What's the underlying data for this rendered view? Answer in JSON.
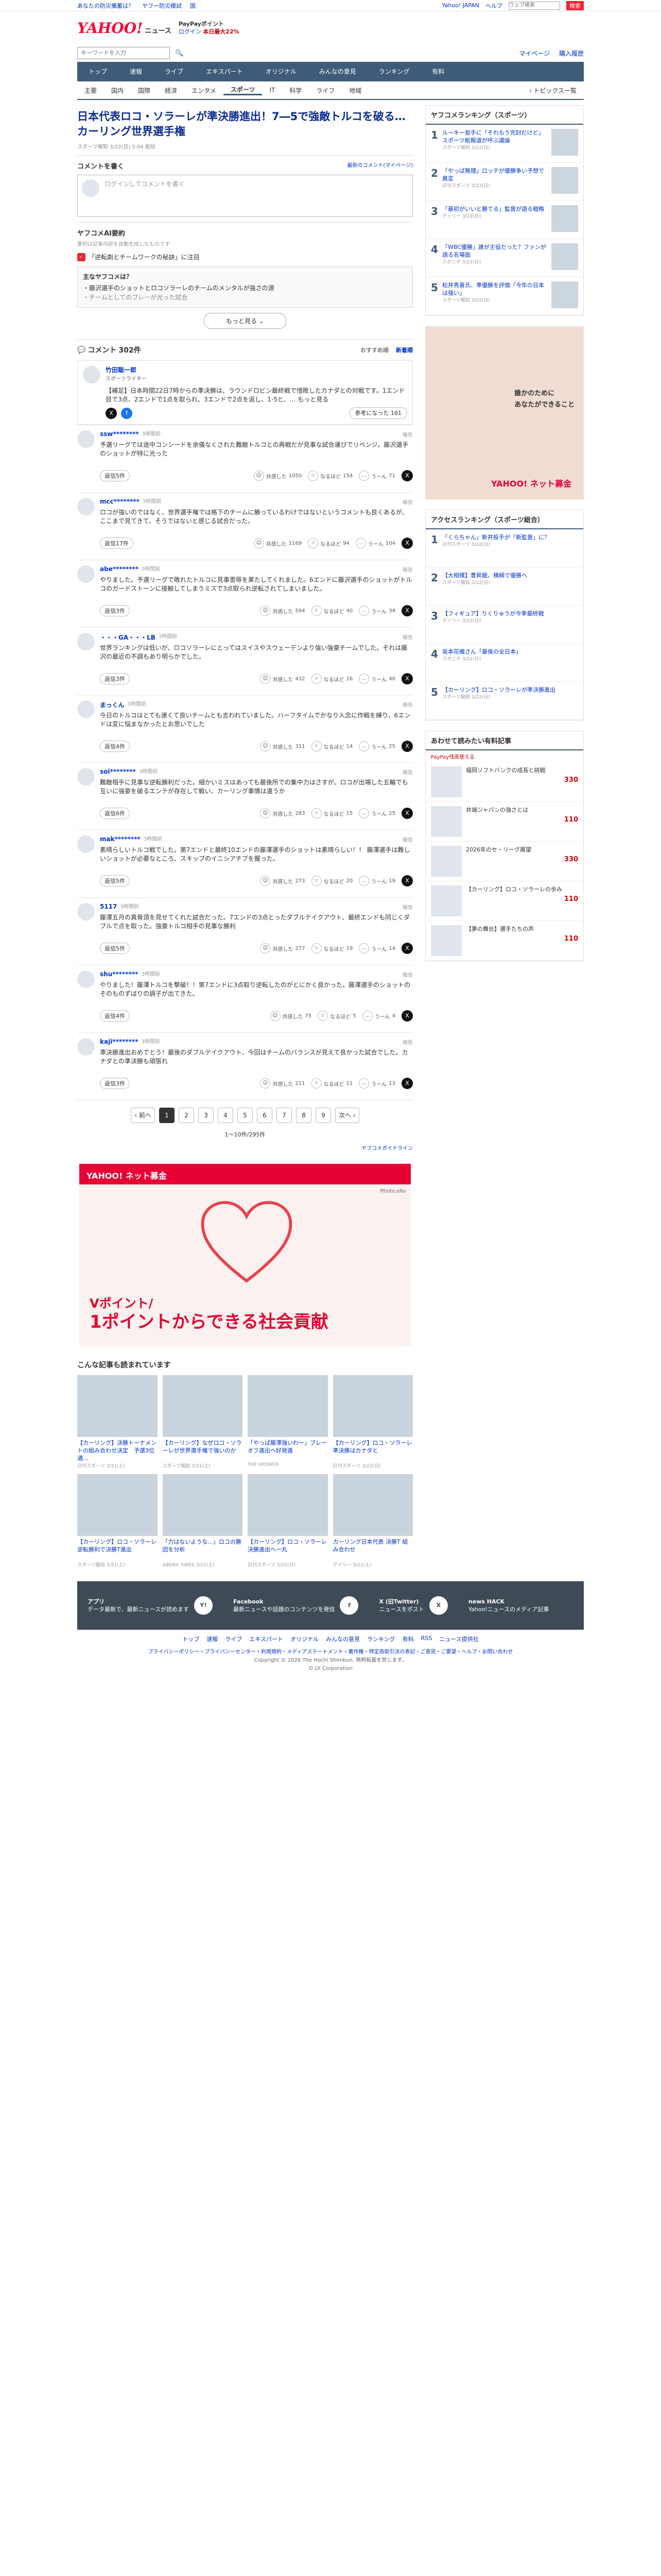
{
  "topline": {
    "links": [
      "あなたの防災備蓄は？",
      "ヤフー防災模試",
      "国"
    ],
    "right": [
      "Yahoo! JAPAN",
      "ヘルプ"
    ],
    "search_placeholder": "ウェブ検索",
    "search_btn": "検索"
  },
  "header": {
    "logo": "YAHOO!",
    "sub": "ニュース",
    "promo1": "PayPayポイント",
    "promo2": "ログイン",
    "promo3": "本日最大22%"
  },
  "search": {
    "placeholder": "キーワードを入力",
    "right": [
      "マイページ",
      "購入履歴"
    ]
  },
  "gnav": [
    "トップ",
    "速報",
    "ライブ",
    "エキスパート",
    "オリジナル",
    "みんなの意見",
    "ランキング",
    "有料"
  ],
  "snav": [
    "主要",
    "国内",
    "国際",
    "経済",
    "エンタメ",
    "スポーツ",
    "IT",
    "科学",
    "ライフ",
    "地域"
  ],
  "snav_right": "トピックス一覧",
  "article": {
    "title": "日本代表ロコ・ソラーレが準決勝進出！7―5で強敵トルコを破る…カーリング世界選手権",
    "meta": "スポーツ報知 3/22(日) 5:04 配信"
  },
  "comment_box": {
    "title": "コメントを書く",
    "right": "最新のコメント(マイページ)",
    "placeholder": "ログインしてコメントを書く"
  },
  "ai": {
    "title": "ヤフコメAI要約",
    "note": "要約は記事内容を自動生成したものです",
    "tag": "「逆転劇とチームワークの秘訣」に注目",
    "box_title": "主なヤフコメは？",
    "b1": "・藤沢選手のショットとロコソラーレのチームのメンタルが強さの源",
    "b2": "・チームとしてのプレーが光った試合",
    "more": "もっと見る"
  },
  "comments_header": {
    "title": "コメント",
    "count": "302件",
    "sort1": "おすすめ順",
    "sort2": "新着順"
  },
  "expert": {
    "name": "竹田聡一郎",
    "role": "スポーツライター",
    "text": "【補足】日本時間22日7時からの準決勝は、ラウンドロビン最終戦で惜敗したカナダとの対戦です。1エンド目で3点、2エンドで1点を取られ、3エンドで2点を返し、1-5と、… もっと見る",
    "btn": "参考になった",
    "count": "161"
  },
  "comments": [
    {
      "name": "ssw********",
      "time": "3時間前",
      "text": "予選リーグでは途中コンシードを余儀なくされた難敵トルコとの再戦だが見事な試合運びでリベンジ。藤沢選手のショットが特に光った",
      "reply": "返信5件",
      "r1": "1050",
      "r2": "154",
      "r3": "71"
    },
    {
      "name": "mcc********",
      "time": "3時間前",
      "text": "ロコが強いのではなく、世界選手権では格下のチームに勝っているわけではないというコメントも良くあるが、ここまで見てきて、そうではないと感じる試合だった。",
      "reply": "返信17件",
      "r1": "1169",
      "r2": "94",
      "r3": "104"
    },
    {
      "name": "abe********",
      "time": "3時間前",
      "text": "やりました。予選リーグで敗れたトルコに見事雪辱を果たしてくれました。6エンドに藤沢選手のショットがトルコのガードストーンに接触してしまうミスで3点取られ逆転されてしまいました。",
      "reply": "返信3件",
      "r1": "594",
      "r2": "40",
      "r3": "34"
    },
    {
      "name": "・・・GA・・・LB",
      "time": "3時間前",
      "text": "世界ランキングは低いが、ロコソラーレにとってはスイスやスウェーデンより強い強豪チームでした。それは藤沢の最近の不調もあり明らかでした。",
      "reply": "返信3件",
      "r1": "432",
      "r2": "26",
      "r3": "40"
    },
    {
      "name": "まっくん",
      "time": "3時間前",
      "text": "今日のトルコはとても速くて良いチームとも言われていました。ハーフタイムでかなり入念に作戦を練り、6エンドは変に悩まなかったとお思いでした",
      "reply": "返信4件",
      "r1": "311",
      "r2": "14",
      "r3": "25"
    },
    {
      "name": "soi********",
      "time": "3時間前",
      "text": "難敵相手に見事な逆転勝利だった。細かいミスはあっても最後所での集中力はさすが。ロコが出場した五輪でも互いに強豪を破るエンテが存在して戦い、カーリング事情は違うか",
      "reply": "返信6件",
      "r1": "283",
      "r2": "15",
      "r3": "25"
    },
    {
      "name": "mak********",
      "time": "3時間前",
      "text": "素晴らしいトルコ戦でした。第7エンドと最終10エンドの藤澤選手のショットは素晴らしい！！ 藤澤選手は難しいショットが必要なところ、スキップのイニシアチブを握った。",
      "reply": "返信5件",
      "r1": "273",
      "r2": "20",
      "r3": "19"
    },
    {
      "name": "5117",
      "time": "3時間前",
      "text": "藤澤五月の真骨頂を見せてくれた試合だった。7エンドの3点とったダブルテイクアウト、最終エンドも同じくダブルで点を取った。強豪トルコ相手の見事な勝利",
      "reply": "返信5件",
      "r1": "277",
      "r2": "19",
      "r3": "14"
    },
    {
      "name": "shu********",
      "time": "3時間前",
      "text": "やりました！藤澤トルコを撃破！！第7エンドに3点取り逆転したのがとにかく良かった。藤澤選手のショットのそのものずばりの調子が出てきた。",
      "reply": "返信4件",
      "r1": "75",
      "r2": "5",
      "r3": "4"
    },
    {
      "name": "kaji********",
      "time": "3時間前",
      "text": "準決勝進出おめでとう！最後のダブルテイクアウト、今回はチームのバランスが見えて良かった試合でした。カナダとの準決勝も頑張れ",
      "reply": "返信3件",
      "r1": "211",
      "r2": "11",
      "r3": "13"
    }
  ],
  "pager": {
    "prev": "前へ",
    "pages": [
      "1",
      "2",
      "3",
      "4",
      "5",
      "6",
      "7",
      "8",
      "9"
    ],
    "next": "次へ",
    "count": "1〜10件/295件"
  },
  "yahoo_guideline": "ヤフコメガイドライン",
  "bigad": {
    "brand": "YAHOO! ネット募金",
    "credit": "Photo.ello",
    "line1": "Vポイント/",
    "line2": "1ポイントからできる社会貢献"
  },
  "related": {
    "title": "こんな記事も読まれています",
    "items": [
      {
        "t": "【カーリング】決勝トーナメントの組み合わせ決定　予選3位通…",
        "m": "日刊スポーツ 3/21(土)"
      },
      {
        "t": "【カーリング】なぜロコ・ソラーレが世界選手権で強いのか",
        "m": "スポーツ報知 3/21(土)"
      },
      {
        "t": "「やっぱ藤澤強いわー」プレーオフ進出へ好発進",
        "m": "THE ANSWER"
      },
      {
        "t": "【カーリング】ロコ・ソラーレ 準決勝はカナダと",
        "m": "日刊スポーツ 3/22(日)"
      },
      {
        "t": "【カーリング】ロコ・ソラーレ逆転勝利で決勝T進出",
        "m": "スポーツ報知 3/21(土)"
      },
      {
        "t": "「力はないような...」ロコの勝因を分析",
        "m": "ABEMA TIMES 3/21(土)"
      },
      {
        "t": "【カーリング】ロコ・ソラーレ 決勝進出へ一丸",
        "m": "日刊スポーツ 3/22(日)"
      },
      {
        "t": "カーリング日本代表 決勝T 組み合わせ",
        "m": "デイリー 3/21(土)"
      }
    ]
  },
  "side_rank": {
    "title": "ヤフコメランキング（スポーツ）",
    "items": [
      {
        "n": "1",
        "t": "ルーキー投手に「それもう完封だけど」スポーツ紙報道が呼ぶ議論",
        "m": "スポーツ報知 3/22(日)"
      },
      {
        "n": "2",
        "t": "「やっぱ無理」ロッテが優勝争い予想で異変",
        "m": "日刊スポーツ 3/22(日)"
      },
      {
        "n": "3",
        "t": "「最初がいいと勝てる」監督が語る戦略",
        "m": "デイリー 3/22(日)"
      },
      {
        "n": "4",
        "t": "「WBC優勝」誰が主役だった？ファンが語る名場面",
        "m": "スポニチ 3/22(日)"
      },
      {
        "n": "5",
        "t": "松井秀喜氏、準優勝を評価「今年の日本は強い」",
        "m": "スポーツ報知 3/22(日)"
      }
    ]
  },
  "sidead": {
    "line1": "誰かのために",
    "line2": "あなたができること",
    "brand": "YAHOO! ネット募金"
  },
  "side_access": {
    "title": "アクセスランキング（スポーツ総合）",
    "items": [
      {
        "n": "1",
        "t": "「くらちゃん」新井投手が「新監督」に？",
        "m": "日刊スポーツ 3/22(日)"
      },
      {
        "n": "2",
        "t": "【大相撲】豊昇龍、横綱で優勝へ",
        "m": "スポーツ報知 3/22(日)"
      },
      {
        "n": "3",
        "t": "【フィギュア】りくりゅうが今季最終戦",
        "m": "デイリー 3/22(日)"
      },
      {
        "n": "4",
        "t": "坂本花織さん「最後の全日本」",
        "m": "スポニチ 3/22(日)"
      },
      {
        "n": "5",
        "t": "【カーリング】ロコ・ソラーレが準決勝進出",
        "m": "スポーツ報知 3/22(日)"
      }
    ]
  },
  "side_shop": {
    "title": "あわせて読みたい有料記事",
    "sub": "PayPay残高使える",
    "items": [
      {
        "t": "福岡ソフトバンクの成長と挑戦",
        "price": "330"
      },
      {
        "t": "井端ジャパンの強さとは",
        "price": "110"
      },
      {
        "t": "2026年のセ・リーグ展望",
        "price": "330"
      },
      {
        "t": "【カーリング】ロコ・ソラーレの歩み",
        "price": "110"
      },
      {
        "t": "【夢の舞台】選手たちの声",
        "price": "110"
      }
    ]
  },
  "footer": {
    "app": "アプリ",
    "app_sub": "データ最新で、最新ニュースが読めます",
    "fb": "Facebook",
    "fb_sub": "最新ニュースや話題のコンテンツを発信",
    "x": "X (旧Twitter)",
    "x_sub": "ニュースをポスト",
    "hack": "news HACK",
    "hack_sub": "Yahoo!ニュースのメディア記事"
  },
  "flinks": [
    "トップ",
    "速報",
    "ライブ",
    "エキスパート",
    "オリジナル",
    "みんなの意見",
    "ランキング",
    "有料",
    "RSS",
    "ニュース提供社"
  ],
  "copy1": "プライバシーポリシー・プライバシーセンター・利用規約・メディアステートメント・著作権・特定商取引法の表記・ご意見・ご要望・ヘルプ・お問い合わせ",
  "copy2": "Copyright © 2026 The Hochi Shimbun. 無断転載を禁じます。",
  "copy3": "© LY Corporation"
}
